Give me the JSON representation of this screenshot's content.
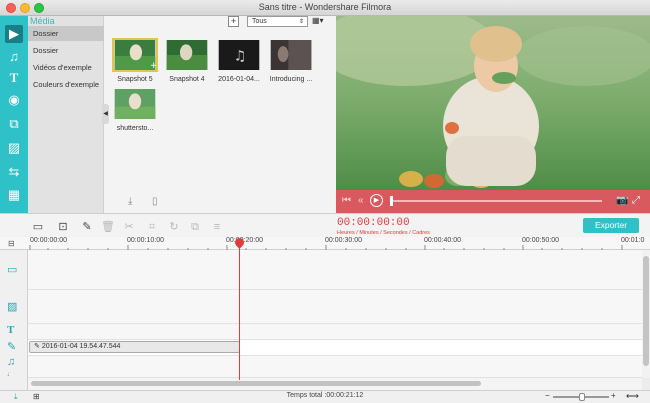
{
  "window": {
    "title": "Sans titre - Wondershare Filmora"
  },
  "media": {
    "panel_title": "Média",
    "folders": [
      "Dossier",
      "Dossier",
      "Vidéos d'exemple",
      "Couleurs d'exemple"
    ],
    "filter": "Tous",
    "thumbnails": [
      {
        "label": "Snapshot 5",
        "icon": "video-frame"
      },
      {
        "label": "Snapshot 4",
        "icon": "video-frame"
      },
      {
        "label": "2016-01-04...",
        "icon": "music-note-icon"
      },
      {
        "label": "Introducing ...",
        "icon": "video-frame"
      },
      {
        "label": "shutterstо...",
        "icon": "video-frame"
      }
    ]
  },
  "timeline": {
    "timecode": "00:00:00:00",
    "timecode_caption": "Heures / Minutes / Secondes / Cadres",
    "export_label": "Exporter",
    "ruler": [
      "00:00:00:00",
      "00:00:10:00",
      "00:00:20:00",
      "00:00:30:00",
      "00:00:40:00",
      "00:00:50:00",
      "00:01:0"
    ],
    "clip_label": "2016-01-04 19.54.47.544",
    "total_time": "Temps total :00:00:21:12"
  },
  "colors": {
    "accent": "#2ec1c8",
    "playbar": "#d95a5e",
    "timecode": "#e03c3c"
  }
}
